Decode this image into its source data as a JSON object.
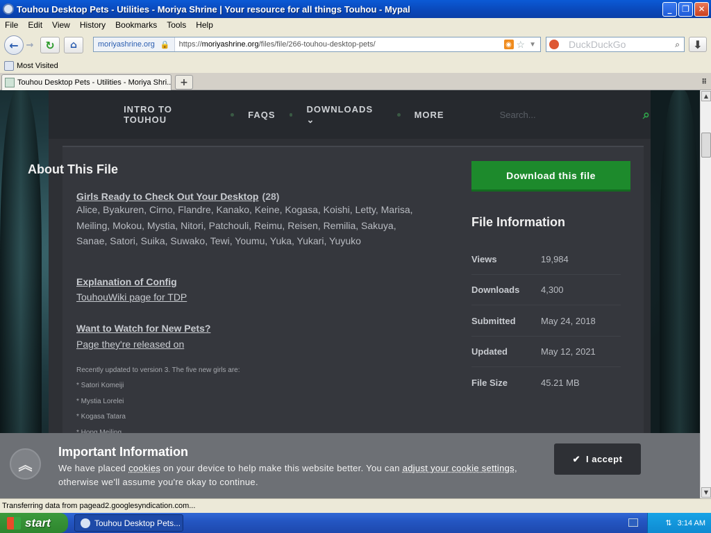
{
  "window": {
    "title": "Touhou Desktop Pets - Utilities - Moriya Shrine | Your resource for all things Touhou - Mypal",
    "minimize": "_",
    "maximize": "❐",
    "close": "✕"
  },
  "menu": [
    "File",
    "Edit",
    "View",
    "History",
    "Bookmarks",
    "Tools",
    "Help"
  ],
  "nav": {
    "site_identity": "moriyashrine.org",
    "url_prefix": "https://",
    "url_host": "moriyashrine.org",
    "url_path": "/files/file/266-touhou-desktop-pets/",
    "search_engine": "DuckDuckGo"
  },
  "bookmarks": {
    "most_visited": "Most Visited"
  },
  "tab": {
    "title": "Touhou Desktop Pets - Utilities - Moriya Shri..."
  },
  "site": {
    "nav_items": [
      "INTRO TO TOUHOU",
      "FAQS",
      "DOWNLOADS",
      "MORE"
    ],
    "search_placeholder": "Search..."
  },
  "about": {
    "title": "About This File",
    "girls_heading": "Girls Ready to Check Out Your Desktop",
    "girls_count": "(28)",
    "girls_line1": "Alice, Byakuren, Cirno, Flandre, Kanako, Keine, Kogasa, Koishi, Letty, Marisa,",
    "girls_line2": "Meiling, Mokou, Mystia, Nitori, Patchouli, Reimu, Reisen, Remilia, Sakuya,",
    "girls_line3": "Sanae, Satori, Suika, Suwako, Tewi, Youmu, Yuka, Yukari, Yuyuko",
    "config_heading": "Explanation of Config",
    "config_link": "TouhouWiki page for TDP",
    "watch_heading": "Want to Watch for New Pets?",
    "watch_link": "Page they're released on",
    "update_note": "Recently updated to version 3.  The five new girls are:",
    "new_girls": [
      "* Satori Komeiji",
      "* Mystia Lorelei",
      "* Kogasa Tatara",
      "* Hong Meiling"
    ]
  },
  "sidebar": {
    "download_label": "Download this file",
    "file_info_title": "File Information",
    "rows": [
      {
        "key": "Views",
        "value": "19,984"
      },
      {
        "key": "Downloads",
        "value": "4,300"
      },
      {
        "key": "Submitted",
        "value": "May 24, 2018"
      },
      {
        "key": "Updated",
        "value": "May 12, 2021"
      },
      {
        "key": "File Size",
        "value": "45.21 MB"
      }
    ]
  },
  "cookie": {
    "title": "Important Information",
    "text_a": "We have placed ",
    "link_cookies": "cookies",
    "text_b": " on your device to help make this website better. You can ",
    "link_settings": "adjust your cookie settings",
    "text_c": ", otherwise we'll assume you're okay to continue.",
    "accept_label": "I accept"
  },
  "status": "Transferring data from pagead2.googlesyndication.com...",
  "taskbar": {
    "start": "start",
    "task_label": "Touhou Desktop Pets...",
    "clock": "3:14 AM"
  }
}
